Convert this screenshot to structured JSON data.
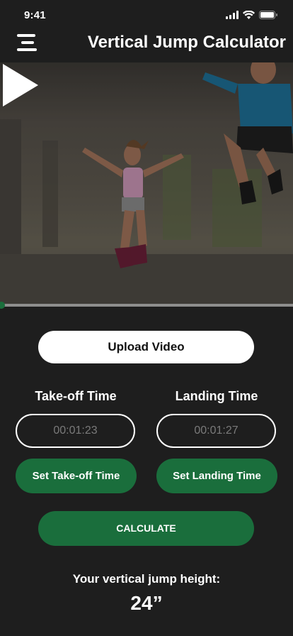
{
  "status_bar": {
    "time": "9:41"
  },
  "header": {
    "title": "Vertical Jump Calculator"
  },
  "video": {
    "progress_fraction": 0.005
  },
  "upload": {
    "label": "Upload Video"
  },
  "takeoff": {
    "label": "Take-off Time",
    "value": "00:01:23",
    "button": "Set Take-off Time"
  },
  "landing": {
    "label": "Landing Time",
    "value": "00:01:27",
    "button": "Set Landing Time"
  },
  "calculate": {
    "label": "CALCULATE"
  },
  "result": {
    "label": "Your vertical jump height:",
    "value": "24”"
  },
  "colors": {
    "accent": "#1a6e3c",
    "background": "#1e1e1e"
  }
}
